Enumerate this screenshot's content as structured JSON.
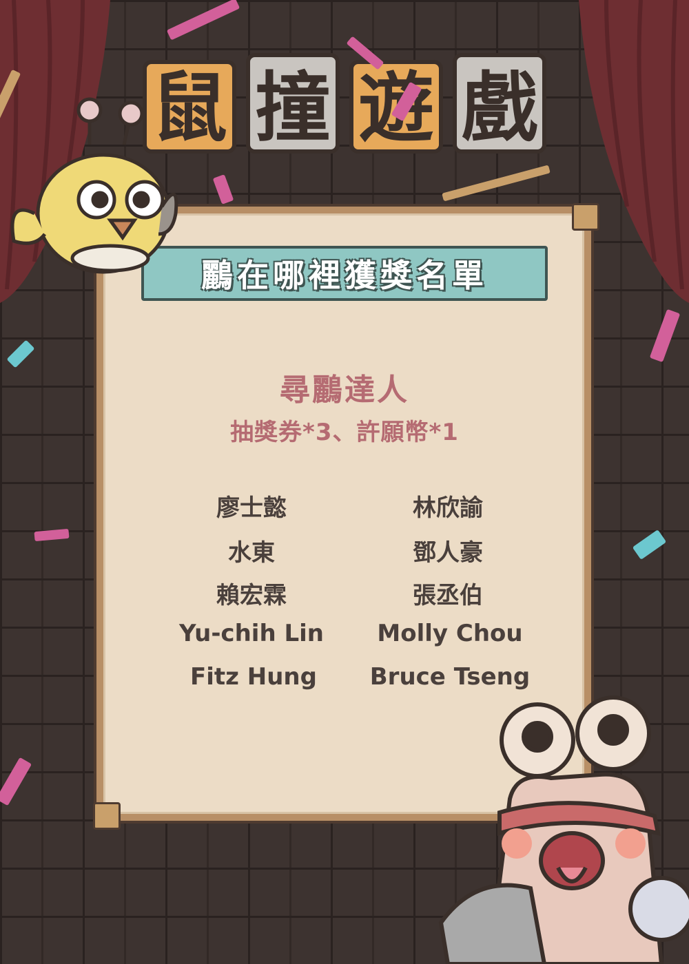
{
  "logo": {
    "title": "鼠撞遊戲"
  },
  "banner": {
    "title": "鸝在哪裡獲獎名單"
  },
  "prize": {
    "title": "尋鸝達人",
    "items": "抽獎券*3、許願幣*1"
  },
  "winners": {
    "left": [
      "廖士懿",
      "水東",
      "賴宏霖",
      "Yu-chih Lin",
      "Fitz Hung"
    ],
    "right": [
      "林欣諭",
      "鄧人豪",
      "張丞伯",
      "Molly Chou",
      "Bruce Tseng"
    ]
  },
  "colors": {
    "background": "#3d3330",
    "curtain": "#6e2e32",
    "board": "#ecdcc6",
    "banner": "#8fc7c3",
    "prize_text": "#b56b72",
    "winner_text": "#4a403c",
    "confetti_pink": "#d2609a",
    "confetti_teal": "#6cc8cf"
  },
  "icons": {
    "bird": "yellow-bird-mascot",
    "snail": "snail-mascot"
  }
}
